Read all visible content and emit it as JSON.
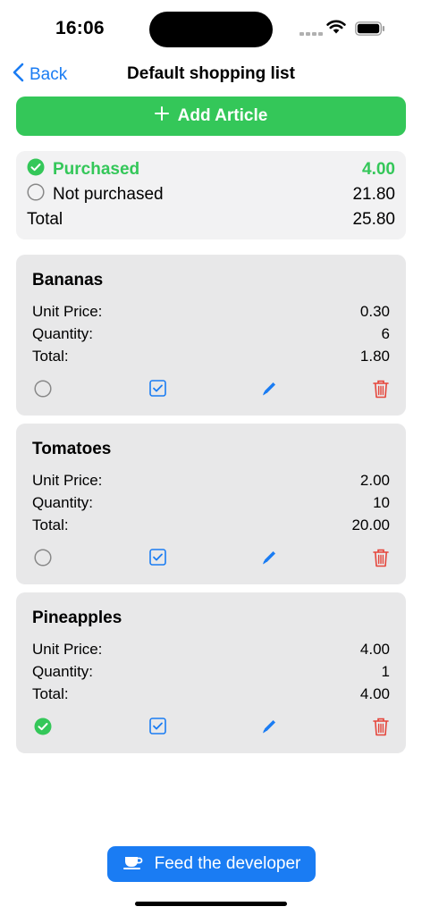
{
  "status_bar": {
    "time": "16:06"
  },
  "nav": {
    "back_label": "Back",
    "title": "Default shopping list"
  },
  "add_button": {
    "label": "Add Article",
    "icon": "plus-icon"
  },
  "summary": {
    "purchased_label": "Purchased",
    "purchased_value": "4.00",
    "not_purchased_label": "Not purchased",
    "not_purchased_value": "21.80",
    "total_label": "Total",
    "total_value": "25.80"
  },
  "labels": {
    "unit_price": "Unit Price:",
    "quantity": "Quantity:",
    "total": "Total:"
  },
  "articles": [
    {
      "name": "Bananas",
      "unit_price": "0.30",
      "quantity": "6",
      "total": "1.80",
      "purchased": false
    },
    {
      "name": "Tomatoes",
      "unit_price": "2.00",
      "quantity": "10",
      "total": "20.00",
      "purchased": false
    },
    {
      "name": "Pineapples",
      "unit_price": "4.00",
      "quantity": "1",
      "total": "4.00",
      "purchased": true
    }
  ],
  "footer": {
    "feed_label": "Feed the developer",
    "icon": "coffee-cup-icon"
  },
  "colors": {
    "accent": "#1a7cf3",
    "green": "#34c759",
    "red": "#e5453b"
  }
}
